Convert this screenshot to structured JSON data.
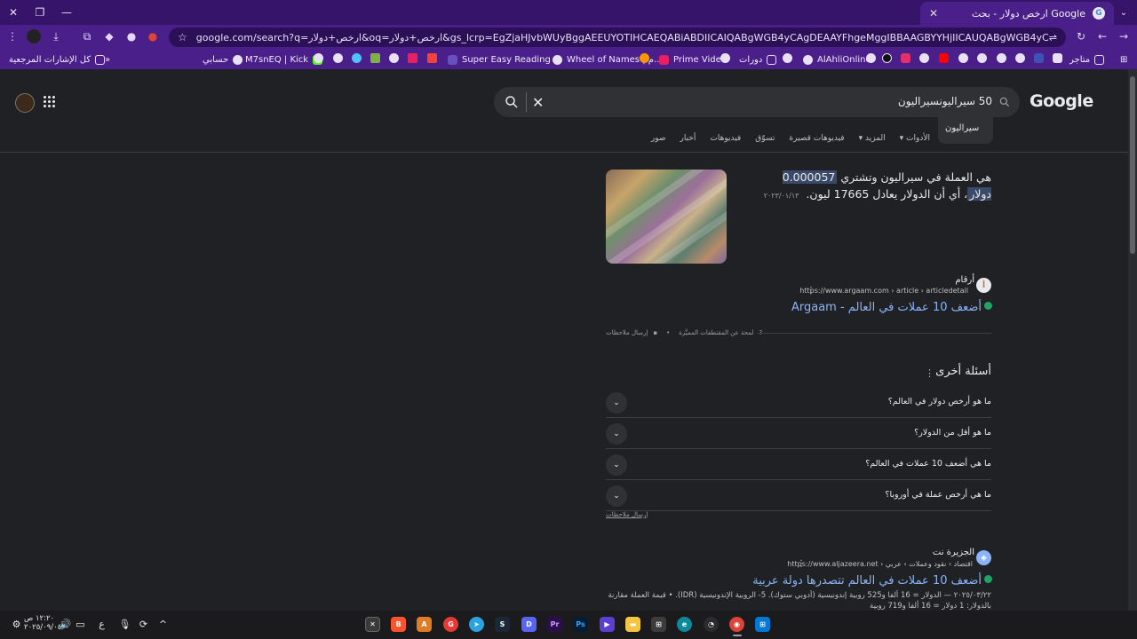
{
  "browser": {
    "tab_title": "ارخص دولار - بحث Google",
    "url": "google.com/search?q=ارخص+دولار&oq=ارخص+دولار&gs_lcrp=EgZjaHJvbWUyBggAEEUYOTIHCAEQABiABDIICAIQABgWGB4yCAgDEAAYFhgeMggIBBAAGBYYHjIICAUQABgWGB4yCAgGEAAYFhgeMggIBxAAGBYYHjIICAgQABgWGB4yCAgJEAAYFhge",
    "bookmarks": [
      {
        "label": "متاجر"
      },
      {
        "label": "AlAhliOnline"
      },
      {
        "label": "دورات"
      },
      {
        "label": "Prime Video"
      },
      {
        "label": "Wheel of Names | م..."
      },
      {
        "label": "Super Easy Reading"
      },
      {
        "label": "M7snEQ | Kick"
      },
      {
        "label": "حسابي"
      },
      {
        "label": "كل الإشارات المرجعية"
      }
    ]
  },
  "search": {
    "logo": "Google",
    "query": "50 سيراليونسيراليون",
    "suggestion": "سيراليون",
    "tabs": [
      "صور",
      "أخبار",
      "فيديوهات",
      "تسوّق",
      "فيديوهات قصيرة",
      "المزيد ▾",
      "الأدوات ▾"
    ]
  },
  "featured": {
    "text_before": "هي العملة في سيراليون وتشتري",
    "highlight": "0.000057 دولار",
    "text_after": "، أي أن الدولار يعادل 17665 ليون.",
    "date": "٢٠٢٣/٠١/١٣",
    "source_name": "أرقام",
    "source_logo": "أ",
    "source_url": "https://www.argaam.com › article › articledetail",
    "title": "أضعف 10 عملات في العالم - Argaam",
    "about": "لمحة عن المقتطفات المميَّزة",
    "feedback": "إرسال ملاحظات"
  },
  "paa": {
    "title": "أسئلة أخرى",
    "questions": [
      "ما هو أرخص دولار في العالم؟",
      "ما هو أقل من الدولار؟",
      "ما هي أضعف 10 عملات في العالم؟",
      "ما هي أرخص عملة في أوروبا؟"
    ],
    "feedback": "إرسال ملاحظات"
  },
  "result2": {
    "source_name": "الجزيرة نت",
    "source_url": "https://www.aljazeera.net › اقتصاد › نقود وعملات › عربي",
    "title": "أضعف 10 عملات في العالم تتصدرها دولة عربية",
    "snippet": "٢٠٢٥/٠٣/٢٢ — الدولار = 16 ألفا و525 روبية إندونيسية (أدوبي ستوك). 5- الروبية الإندونيسية (IDR). • قيمة العملة مقارنة بالدولار: 1 دولار = 16 ألفا و719 روبية"
  },
  "taskbar": {
    "time": "١٢:٢٠ ص",
    "date": "٢٠٢٥/٠٩/٠٤",
    "lang": "ع"
  }
}
